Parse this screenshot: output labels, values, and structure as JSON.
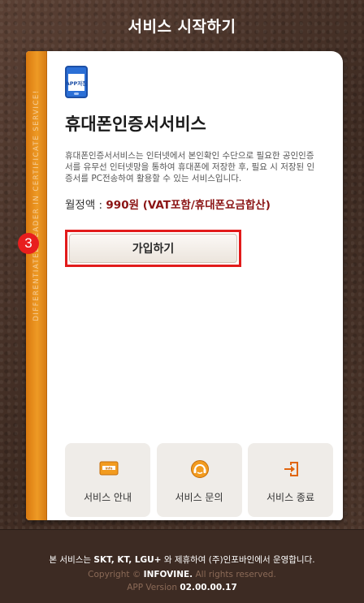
{
  "header": {
    "title": "서비스 시작하기"
  },
  "ribbon": {
    "text": "DIFFERENTIATED LEADER IN CERTIFICATE SERVICE!"
  },
  "app_icon": {
    "label": "APP저장"
  },
  "service": {
    "title": "휴대폰인증서서비스",
    "description": "휴대폰인증서서비스는 인터넷에서 본인확인 수단으로 필요한 공인인증서를 유무선 인터넷망을 통하여 휴대폰에 저장한 후, 필요 시 저장된 인증서를 PC전송하여 활용할 수 있는 서비스입니다.",
    "price_label": "월정액 : ",
    "price_value": "990원 (VAT포함/휴대폰요금합산)"
  },
  "join": {
    "label": "가입하기",
    "step": "3"
  },
  "menu": [
    {
      "label": "서비스 안내",
      "icon": "info-card-icon"
    },
    {
      "label": "서비스 문의",
      "icon": "headset-icon"
    },
    {
      "label": "서비스 종료",
      "icon": "exit-door-icon"
    }
  ],
  "footer": {
    "line1_prefix": "본 서비스는 ",
    "line1_carriers": "SKT, KT, LGU+",
    "line1_suffix": " 와 제휴하여 (주)인포바인에서 운영합니다.",
    "copyright_prefix": "Copyright © ",
    "copyright_company": "INFOVINE.",
    "copyright_suffix": " All rights reserved.",
    "version_label": "APP Version ",
    "version_value": "02.00.00.17"
  },
  "colors": {
    "accent_red": "#e21b1b",
    "price_red": "#8b1414",
    "ribbon_orange": "#ee9a25",
    "leather_brown": "#4a342a"
  }
}
